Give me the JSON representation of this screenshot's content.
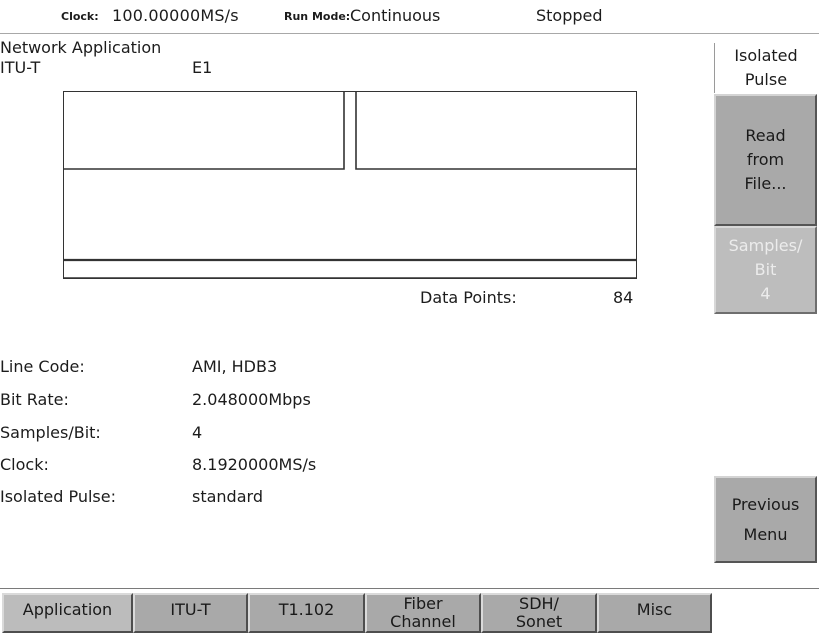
{
  "status": {
    "clock_label": "Clock:",
    "clock_value": "100.00000MS/s",
    "run_mode_label": "Run Mode:",
    "run_mode_value": "Continuous",
    "state": "Stopped"
  },
  "main": {
    "title": "Network Application",
    "standard": "ITU-T",
    "format": "E1",
    "data_points_label": "Data Points:",
    "data_points_value": "84",
    "params": [
      {
        "label": "Line Code:",
        "value": "AMI, HDB3"
      },
      {
        "label": "Bit Rate:",
        "value": "2.048000Mbps"
      },
      {
        "label": "Samples/Bit:",
        "value": "4"
      },
      {
        "label": "Clock:",
        "value": "8.1920000MS/s"
      },
      {
        "label": "Isolated Pulse:",
        "value": "standard"
      }
    ]
  },
  "side_menu": {
    "title": "Isolated\nPulse",
    "read_from_file": "Read\nfrom\nFile...",
    "samples_per_bit": "Samples/\nBit\n4",
    "previous_menu": "Previous\nMenu"
  },
  "bottom_menu": {
    "tabs": [
      "Application",
      "ITU-T",
      "T1.102",
      "Fiber\nChannel",
      "SDH/\nSonet",
      "Misc"
    ]
  },
  "colors": {
    "button_gray": "#a9a9a9",
    "disabled_text": "#ececec",
    "waveform": "#333333"
  }
}
